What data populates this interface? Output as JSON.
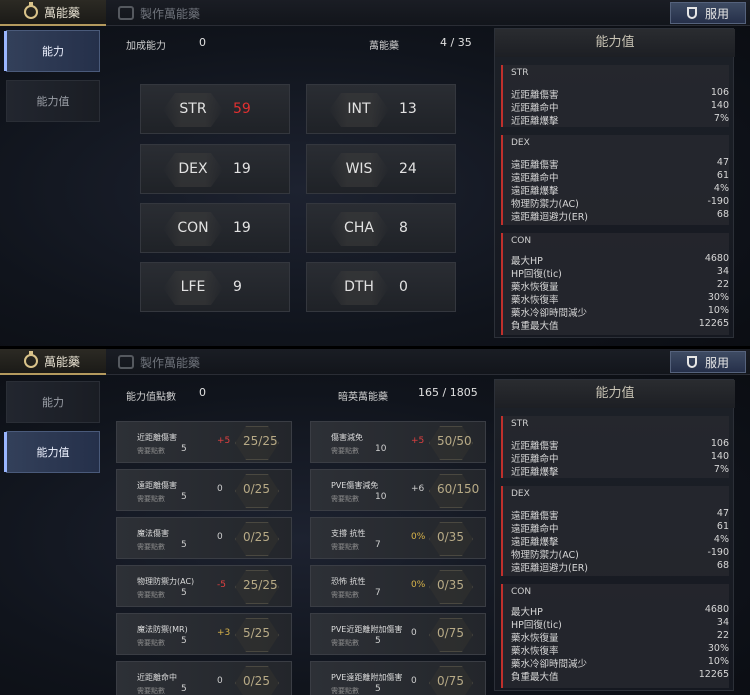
{
  "topbar": {
    "active_tab": "萬能藥",
    "inactive_tab": "製作萬能藥",
    "use_button": "服用"
  },
  "nav": {
    "ability": "能力",
    "ability_value": "能力值"
  },
  "panel1": {
    "header_left_label": "加成能力",
    "header_left_value": "0",
    "header_right_label": "萬能藥",
    "header_right_value": "4 / 35",
    "stats": [
      {
        "name": "STR",
        "value": "59",
        "highlight": true
      },
      {
        "name": "INT",
        "value": "13",
        "highlight": false
      },
      {
        "name": "DEX",
        "value": "19",
        "highlight": false
      },
      {
        "name": "WIS",
        "value": "24",
        "highlight": false
      },
      {
        "name": "CON",
        "value": "19",
        "highlight": false
      },
      {
        "name": "CHA",
        "value": "8",
        "highlight": false
      },
      {
        "name": "LFE",
        "value": "9",
        "highlight": false
      },
      {
        "name": "DTH",
        "value": "0",
        "highlight": false
      }
    ]
  },
  "panel2": {
    "header_left_label": "能力值點數",
    "header_left_value": "0",
    "header_right_label": "暗英萬能藥",
    "header_right_value": "165 / 1805",
    "need_label": "需要點數",
    "left_rows": [
      {
        "name": "近距離傷害",
        "bonus": "+5",
        "bonus_color": "red",
        "progress": "25/25",
        "need": "5"
      },
      {
        "name": "遠距離傷害",
        "bonus": "0",
        "bonus_color": "normal",
        "progress": "0/25",
        "need": "5"
      },
      {
        "name": "魔法傷害",
        "bonus": "0",
        "bonus_color": "normal",
        "progress": "0/25",
        "need": "5"
      },
      {
        "name": "物理防禦力(AC)",
        "bonus": "-5",
        "bonus_color": "red",
        "progress": "25/25",
        "need": "5"
      },
      {
        "name": "魔法防禦(MR)",
        "bonus": "+3",
        "bonus_color": "gold",
        "progress": "5/25",
        "need": "5"
      },
      {
        "name": "近距離命中",
        "bonus": "0",
        "bonus_color": "normal",
        "progress": "0/25",
        "need": "5"
      }
    ],
    "right_rows": [
      {
        "name": "傷害減免",
        "bonus": "+5",
        "bonus_color": "red",
        "progress": "50/50",
        "need": "10"
      },
      {
        "name": "PVE傷害減免",
        "bonus": "+6",
        "bonus_color": "normal",
        "progress": "60/150",
        "need": "10"
      },
      {
        "name": "支撐 抗性",
        "bonus": "0%",
        "bonus_color": "gold",
        "progress": "0/35",
        "need": "7"
      },
      {
        "name": "恐怖 抗性",
        "bonus": "0%",
        "bonus_color": "gold",
        "progress": "0/35",
        "need": "7"
      },
      {
        "name": "PVE近距離附加傷害",
        "bonus": "0",
        "bonus_color": "normal",
        "progress": "0/75",
        "need": "5"
      },
      {
        "name": "PVE遠距離附加傷害",
        "bonus": "0",
        "bonus_color": "normal",
        "progress": "0/75",
        "need": "5"
      }
    ]
  },
  "stat_panel": {
    "title": "能力值",
    "sections": [
      {
        "name": "STR",
        "rows": [
          {
            "label": "近距離傷害",
            "value": "106"
          },
          {
            "label": "近距離命中",
            "value": "140"
          },
          {
            "label": "近距離爆擊",
            "value": "7%"
          }
        ]
      },
      {
        "name": "DEX",
        "rows": [
          {
            "label": "遠距離傷害",
            "value": "47"
          },
          {
            "label": "遠距離命中",
            "value": "61"
          },
          {
            "label": "遠距離爆擊",
            "value": "4%"
          },
          {
            "label": "物理防禦力(AC)",
            "value": "-190"
          },
          {
            "label": "遠距離迴避力(ER)",
            "value": "68"
          }
        ]
      },
      {
        "name": "CON",
        "rows": [
          {
            "label": "最大HP",
            "value": "4680"
          },
          {
            "label": "HP回復(tic)",
            "value": "34"
          },
          {
            "label": "藥水恢復量",
            "value": "22"
          },
          {
            "label": "藥水恢復率",
            "value": "30%"
          },
          {
            "label": "藥水冷卻時間減少",
            "value": "10%"
          },
          {
            "label": "負重最大值",
            "value": "12265"
          }
        ]
      }
    ]
  }
}
